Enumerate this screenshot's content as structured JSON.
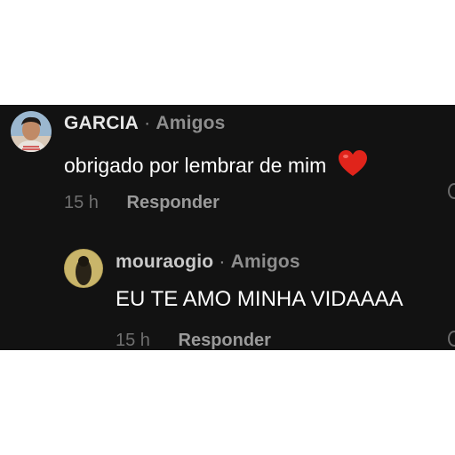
{
  "comments": [
    {
      "username": "GARCIA",
      "separator": "·",
      "relation": "Amigos",
      "text": "obrigado por lembrar de mim",
      "reaction_icon": "red-heart-icon",
      "time": "15 h",
      "reply_label": "Responder",
      "accent": "#e0241b"
    },
    {
      "username": "mouraogio",
      "separator": "·",
      "relation": "Amigos",
      "text": "EU TE AMO MINHA VIDAAAA",
      "time": "15 h",
      "reply_label": "Responder"
    }
  ],
  "colors": {
    "background": "#121212",
    "primary_text": "#ffffff",
    "secondary_text": "#8d8d8d"
  }
}
